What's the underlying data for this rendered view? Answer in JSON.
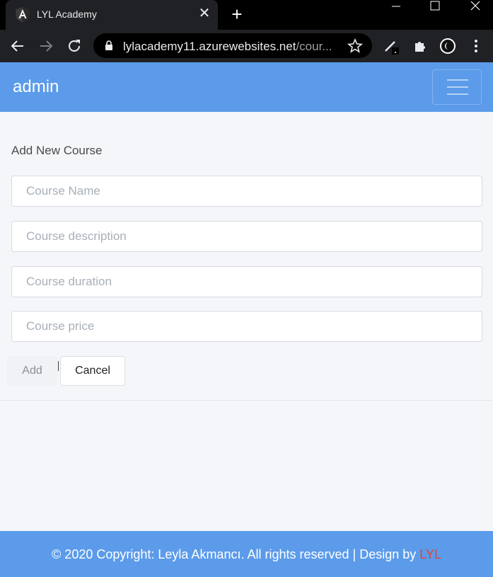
{
  "browser": {
    "tab_title": "LYL Academy",
    "url_host": "lylacademy11.azurewebsites.net",
    "url_path": "/cour..."
  },
  "navbar": {
    "brand": "admin"
  },
  "form": {
    "title": "Add New Course",
    "fields": [
      {
        "placeholder": "Course Name",
        "value": ""
      },
      {
        "placeholder": "Course description",
        "value": ""
      },
      {
        "placeholder": "Course duration",
        "value": ""
      },
      {
        "placeholder": "Course price",
        "value": ""
      }
    ],
    "add_label": "Add",
    "cancel_label": "Cancel"
  },
  "footer": {
    "text": "© 2020 Copyright: Leyla Akmancı. All rights reserved | Design by ",
    "brand": "LYL"
  },
  "colors": {
    "navbar": "#5b9bea",
    "footer_brand": "#e8432f"
  }
}
